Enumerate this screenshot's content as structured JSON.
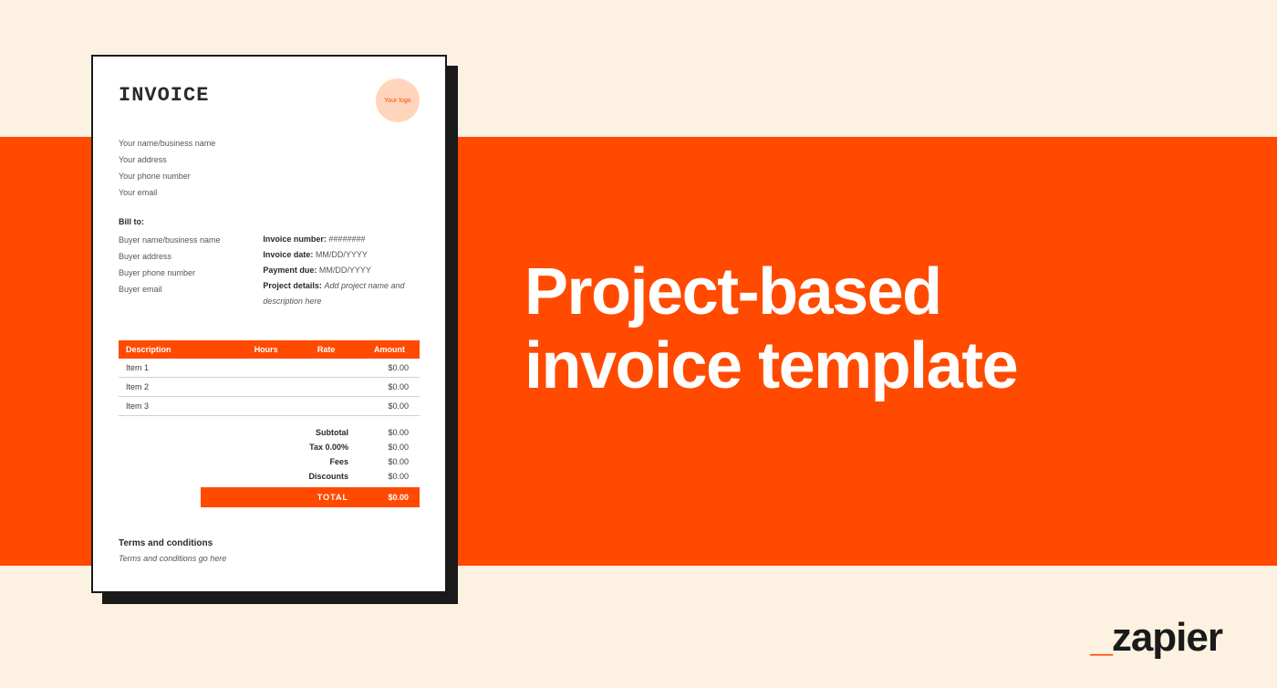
{
  "headline_line1": "Project-based",
  "headline_line2": "invoice template",
  "brand": "zapier",
  "invoice": {
    "title": "INVOICE",
    "logo_text": "Your logo",
    "sender": {
      "name": "Your name/business name",
      "address": "Your address",
      "phone": "Your phone number",
      "email": "Your email"
    },
    "bill_to_label": "Bill to:",
    "buyer": {
      "name": "Buyer name/business name",
      "address": "Buyer address",
      "phone": "Buyer phone number",
      "email": "Buyer email"
    },
    "meta": {
      "invoice_number_label": "Invoice number:",
      "invoice_number_value": "########",
      "invoice_date_label": "Invoice date:",
      "invoice_date_value": "MM/DD/YYYY",
      "payment_due_label": "Payment due:",
      "payment_due_value": "MM/DD/YYYY",
      "project_details_label": "Project details:",
      "project_details_value": "Add project name and description here"
    },
    "table": {
      "headers": {
        "description": "Description",
        "hours": "Hours",
        "rate": "Rate",
        "amount": "Amount"
      },
      "rows": [
        {
          "description": "Item 1",
          "amount": "$0.00"
        },
        {
          "description": "Item 2",
          "amount": "$0.00"
        },
        {
          "description": "Item 3",
          "amount": "$0.00"
        }
      ]
    },
    "summary": {
      "subtotal_label": "Subtotal",
      "subtotal_value": "$0.00",
      "tax_label": "Tax 0.00%",
      "tax_value": "$0.00",
      "fees_label": "Fees",
      "fees_value": "$0.00",
      "discounts_label": "Discounts",
      "discounts_value": "$0.00",
      "total_label": "TOTAL",
      "total_value": "$0.00"
    },
    "terms_title": "Terms and conditions",
    "terms_body": "Terms and conditions go here"
  }
}
